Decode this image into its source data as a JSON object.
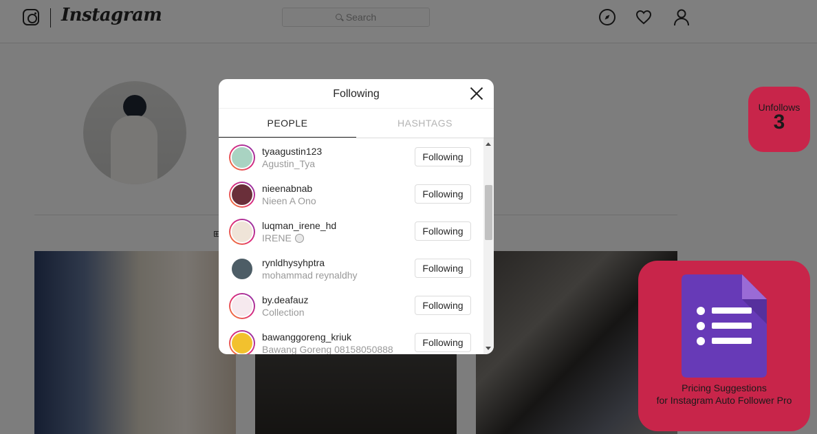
{
  "app": {
    "wordmark": "Instagram",
    "search_placeholder": "Search"
  },
  "profile": {
    "grid_tab_label": "⊞"
  },
  "dialog": {
    "title": "Following",
    "tabs": [
      "PEOPLE",
      "HASHTAGS"
    ],
    "active_tab": "PEOPLE",
    "accounts": [
      {
        "username": "tyaagustin123",
        "fullname": "Agustin_Tya",
        "button": "Following",
        "verified": false,
        "avatar_color": "#a9d3c2"
      },
      {
        "username": "nieenabnab",
        "fullname": "Nieen A Ono",
        "button": "Following",
        "verified": false,
        "avatar_color": "#6a2f3a"
      },
      {
        "username": "luqman_irene_hd",
        "fullname": "IRENE",
        "button": "Following",
        "verified": true,
        "avatar_color": "#efe4d8"
      },
      {
        "username": "rynldhysyhptra",
        "fullname": "mohammad reynaldhy",
        "button": "Following",
        "verified": false,
        "avatar_color": "#4d5d66"
      },
      {
        "username": "by.deafauz",
        "fullname": "Collection",
        "button": "Following",
        "verified": false,
        "avatar_color": "#f6e9ee"
      },
      {
        "username": "bawanggoreng_kriuk",
        "fullname": "Bawang Goreng 08158050888",
        "button": "Following",
        "verified": false,
        "avatar_color": "#f2c12e"
      }
    ]
  },
  "extension": {
    "unfollows_label": "Unfollows",
    "unfollows_count": "3",
    "pricing_line1": "Pricing Suggestions",
    "pricing_line2": "for Instagram Auto Follower Pro",
    "accent_color": "#c8254a"
  }
}
